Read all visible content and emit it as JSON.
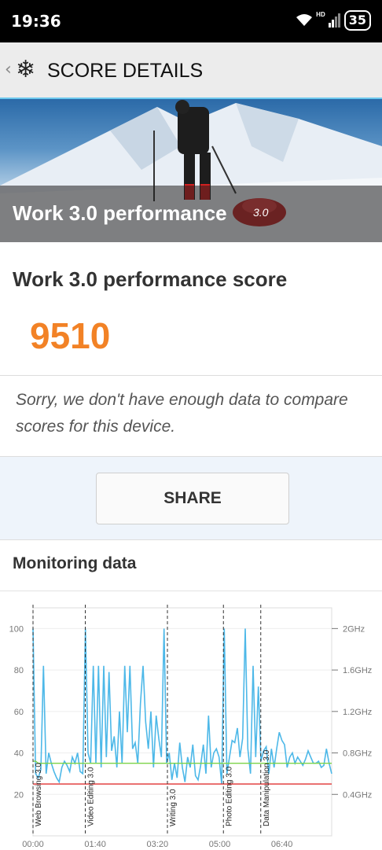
{
  "status": {
    "time": "19:36",
    "battery": "35",
    "network": "HD"
  },
  "appbar": {
    "back_icon": "chevron-left-icon",
    "logo_icon": "snowflake-icon",
    "title": "SCORE DETAILS"
  },
  "hero": {
    "title": "Work 3.0 performance",
    "version": "3.0"
  },
  "score": {
    "title": "Work 3.0 performance score",
    "value": "9510",
    "value_color": "#f28226",
    "message": "Sorry, we don't have enough data to compare scores for this device."
  },
  "share_label": "SHARE",
  "monitoring": {
    "title": "Monitoring data"
  },
  "chart_data": {
    "type": "line",
    "y_left_ticks": [
      "100",
      "80",
      "60",
      "40",
      "20"
    ],
    "y_right_ticks": [
      "2GHz",
      "1.6GHz",
      "1.2GHz",
      "0.8GHz",
      "0.4GHz"
    ],
    "x_ticks": [
      "00:00",
      "01:40",
      "03:20",
      "05:00",
      "06:40"
    ],
    "markers": [
      {
        "t": 0.0,
        "label": "Web Browsing 3.0"
      },
      {
        "t": 1.4,
        "label": "Video Editing 3.0"
      },
      {
        "t": 3.6,
        "label": "Writing 3.0"
      },
      {
        "t": 5.1,
        "label": "Photo Editing 3.0"
      },
      {
        "t": 6.1,
        "label": "Data Manipulation 3.0"
      }
    ],
    "series": [
      {
        "name": "",
        "color": "#4db8e8",
        "values": [
          100,
          30,
          28,
          32,
          82,
          30,
          40,
          35,
          31,
          28,
          26,
          33,
          36,
          34,
          31,
          38,
          35,
          40,
          31,
          30,
          100,
          40,
          35,
          82,
          35,
          82,
          33,
          82,
          38,
          79,
          41,
          48,
          33,
          60,
          35,
          82,
          50,
          82,
          42,
          45,
          35,
          64,
          82,
          55,
          42,
          60,
          33,
          58,
          47,
          38,
          100,
          35,
          40,
          27,
          35,
          28,
          45,
          33,
          26,
          38,
          33,
          44,
          29,
          27,
          34,
          44,
          30,
          58,
          33,
          40,
          42,
          38,
          25,
          100,
          30,
          38,
          46,
          45,
          52,
          38,
          47,
          100,
          42,
          30,
          82,
          38,
          72,
          36,
          41,
          43,
          30,
          42,
          33,
          42,
          50,
          46,
          44,
          33,
          38,
          40,
          35,
          38,
          36,
          34,
          37,
          41,
          38,
          35,
          35,
          36,
          33,
          34,
          42,
          35,
          30
        ]
      },
      {
        "name": "",
        "color": "#7cd44a",
        "values": [
          36,
          36,
          35,
          35,
          35,
          35,
          35,
          35,
          35,
          35,
          35,
          35,
          35,
          35,
          35,
          35,
          35,
          35,
          35,
          35,
          35,
          35,
          35,
          35,
          35,
          35,
          35,
          35,
          35,
          35,
          35,
          35,
          35,
          35,
          35,
          35,
          35,
          35,
          35,
          35,
          35,
          35,
          35,
          35,
          35,
          35,
          35,
          35,
          35,
          35,
          35,
          35,
          35,
          35,
          35,
          35,
          35,
          35,
          35,
          35,
          35,
          35,
          35,
          35,
          35,
          35,
          35,
          35,
          35,
          35,
          35,
          35,
          35,
          35,
          35,
          35,
          35,
          35,
          35,
          35,
          35,
          35,
          35,
          35,
          35,
          35,
          35,
          35,
          35,
          35,
          35,
          35,
          35,
          35,
          35,
          35,
          35,
          35,
          35,
          35,
          35,
          35,
          35,
          35,
          35,
          35,
          35,
          35,
          35,
          35,
          35,
          35,
          35,
          35,
          35
        ]
      },
      {
        "name": "",
        "color": "#e03030",
        "values": [
          25,
          25,
          25,
          25,
          25,
          25,
          25,
          25,
          25,
          25,
          25,
          25,
          25,
          25,
          25,
          25,
          25,
          25,
          25,
          25,
          25,
          25,
          25,
          25,
          25,
          25,
          25,
          25,
          25,
          25,
          25,
          25,
          25,
          25,
          25,
          25,
          25,
          25,
          25,
          25,
          25,
          25,
          25,
          25,
          25,
          25,
          25,
          25,
          25,
          25,
          25,
          25,
          25,
          25,
          25,
          25,
          25,
          25,
          25,
          25,
          25,
          25,
          25,
          25,
          25,
          25,
          25,
          25,
          25,
          25,
          25,
          25,
          25,
          25,
          25,
          25,
          25,
          25,
          25,
          25,
          25,
          25,
          25,
          25,
          25,
          25,
          25,
          25,
          25,
          25,
          25,
          25,
          25,
          25,
          25,
          25,
          25,
          25,
          25,
          25,
          25,
          25,
          25,
          25,
          25,
          25,
          25,
          25,
          25,
          25,
          25,
          25,
          25,
          25,
          25
        ]
      }
    ],
    "ylim": [
      0,
      110
    ]
  }
}
